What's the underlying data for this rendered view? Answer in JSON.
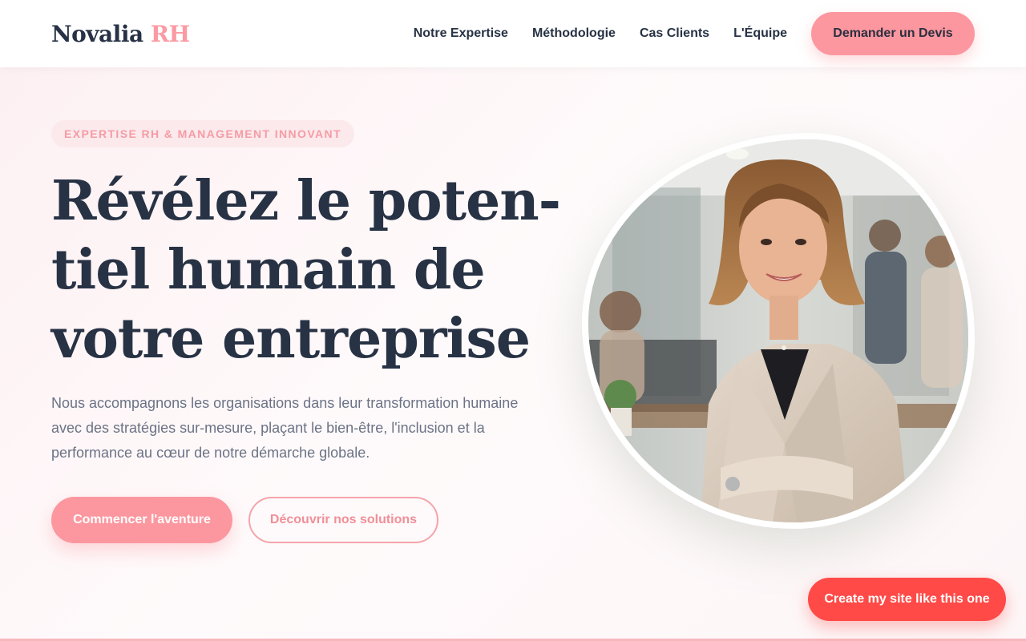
{
  "header": {
    "logo_main": "Novalia",
    "logo_accent": "RH",
    "nav": [
      {
        "label": "Notre Expertise"
      },
      {
        "label": "Méthodologie"
      },
      {
        "label": "Cas Clients"
      },
      {
        "label": "L'Équipe"
      }
    ],
    "quote_button": "Demander un Devis"
  },
  "hero": {
    "badge": "EXPERTISE RH & MANAGEMENT INNOVANT",
    "headline_lines": [
      "Révélez le poten-",
      "tiel humain de",
      "votre entreprise"
    ],
    "lead": "Nous accompagnons les organisations dans leur transformation humaine avec des stratégies sur-mesure, plaçant le bien-être, l'inclusion et la performance au cœur de notre démarche globale.",
    "primary_button": "Commencer l'aventure",
    "secondary_button": "Découvrir nos solutions"
  },
  "floating_cta": "Create my site like this one",
  "colors": {
    "accent": "#fc979f",
    "navy": "#273244",
    "muted_text": "#6b7385",
    "floating_cta": "#ff4a47"
  }
}
